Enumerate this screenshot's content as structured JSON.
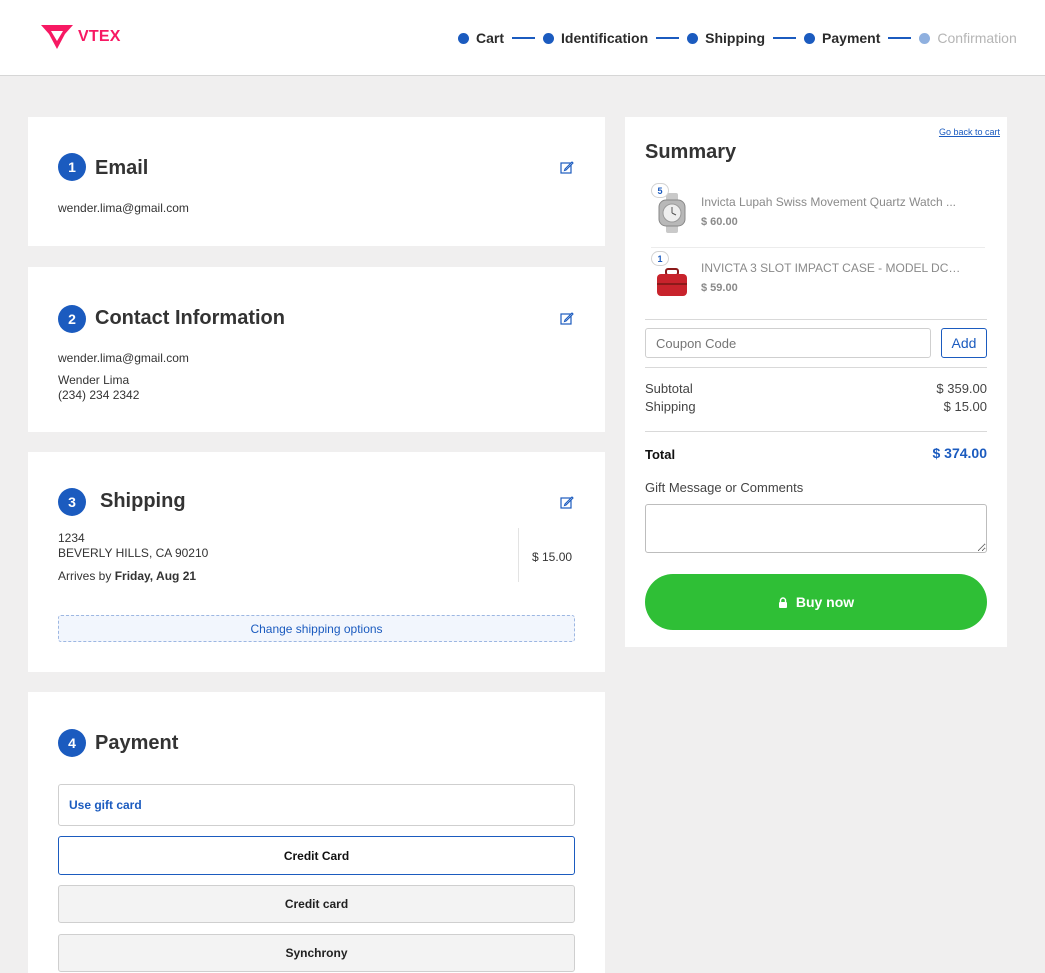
{
  "header": {
    "logo_text": "VTEX",
    "steps": [
      {
        "label": "Cart",
        "state": "done"
      },
      {
        "label": "Identification",
        "state": "done"
      },
      {
        "label": "Shipping",
        "state": "done"
      },
      {
        "label": "Payment",
        "state": "current"
      },
      {
        "label": "Confirmation",
        "state": "pending"
      }
    ]
  },
  "email": {
    "number": "1",
    "title": "Email",
    "value": "wender.lima@gmail.com",
    "edit_icon": "edit-icon"
  },
  "contact": {
    "number": "2",
    "title": "Contact Information",
    "email": "wender.lima@gmail.com",
    "name": "Wender Lima",
    "phone": "(234) 234 2342",
    "edit_icon": "edit-icon"
  },
  "shipping": {
    "number": "3",
    "title": "Shipping",
    "address_line1": "1234",
    "address_line2": "BEVERLY HILLS, CA 90210",
    "arrives_prefix": "Arrives by",
    "arrives_date": "Friday, Aug 21",
    "price": "$ 15.00",
    "change_label": "Change shipping options",
    "edit_icon": "edit-icon"
  },
  "payment": {
    "number": "4",
    "title": "Payment",
    "gift_card_label": "Use gift card",
    "options": [
      "Credit Card",
      "Credit card",
      "Synchrony"
    ]
  },
  "summary": {
    "title": "Summary",
    "back_link": "Go back to cart",
    "items": [
      {
        "qty": "5",
        "name": "Invicta Lupah Swiss Movement Quartz Watch ...",
        "price": "$ 60.00"
      },
      {
        "qty": "1",
        "name": "INVICTA 3 SLOT IMPACT CASE - MODEL DC3...",
        "price": "$ 59.00"
      }
    ],
    "coupon_placeholder": "Coupon Code",
    "coupon_add": "Add",
    "subtotal_label": "Subtotal",
    "subtotal_value": "$ 359.00",
    "shipping_label": "Shipping",
    "shipping_value": "$ 15.00",
    "total_label": "Total",
    "total_value": "$ 374.00",
    "gift_message_label": "Gift Message or Comments",
    "buy_label": "Buy now"
  },
  "colors": {
    "brand": "#f71963",
    "accent": "#1b5bbf",
    "buy": "#2fbf36",
    "background": "#f0efef"
  }
}
